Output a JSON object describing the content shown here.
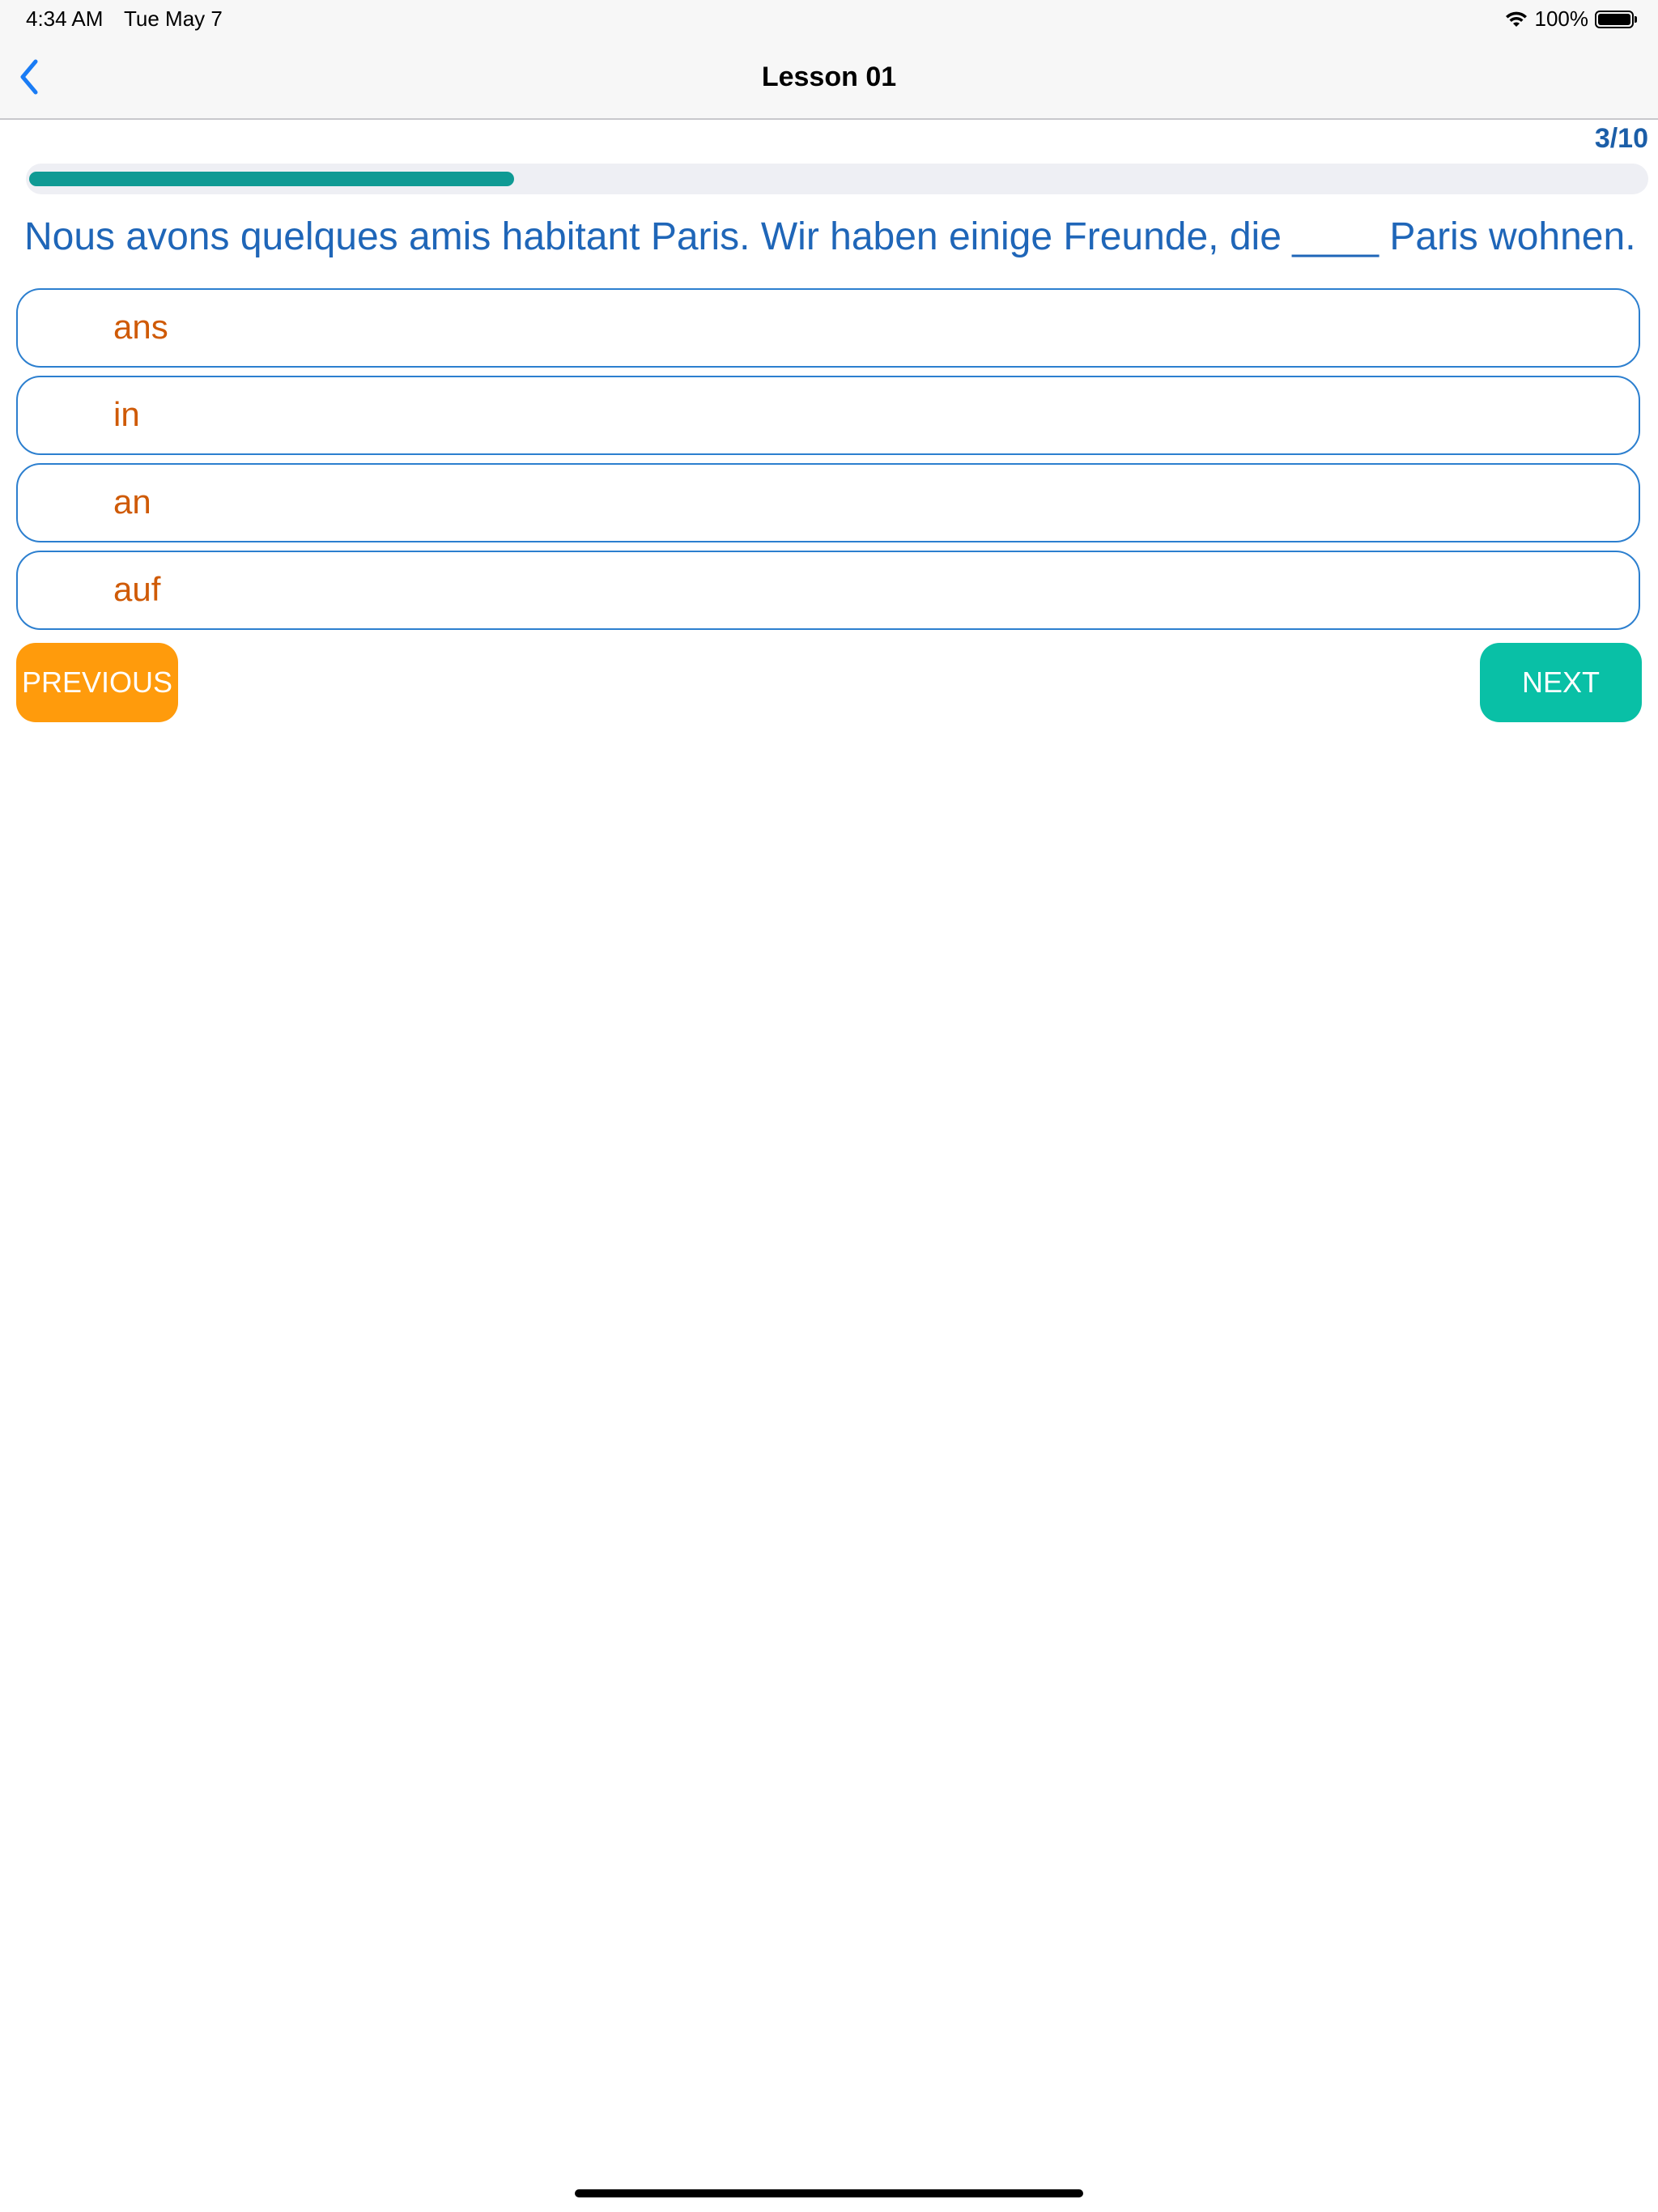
{
  "status_bar": {
    "time": "4:34 AM",
    "date": "Tue May 7",
    "battery": "100%",
    "battery_level": 1.0
  },
  "nav": {
    "title": "Lesson 01"
  },
  "progress": {
    "label": "3/10",
    "fraction": 0.3
  },
  "question": {
    "text": "Nous avons quelques amis habitant Paris. Wir haben einige Freunde, die ____ Paris wohnen."
  },
  "options": [
    {
      "label": "ans"
    },
    {
      "label": "in"
    },
    {
      "label": "an"
    },
    {
      "label": "auf"
    }
  ],
  "buttons": {
    "previous": "PREVIOUS",
    "next": "NEXT"
  },
  "colors": {
    "accent_blue": "#1f66b8",
    "option_text": "#cf5a06",
    "previous_button": "#ff9b0c",
    "next_button": "#09c0a6",
    "progress_fill": "#0f9a94"
  }
}
